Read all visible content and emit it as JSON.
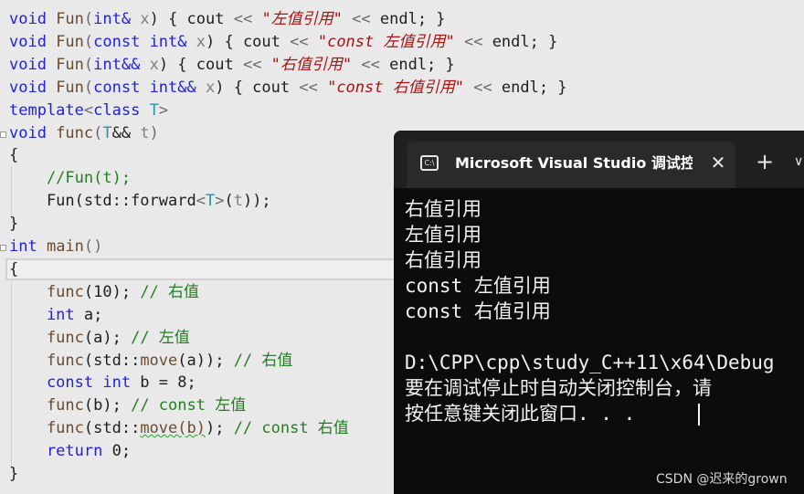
{
  "editor": {
    "lines": [
      {
        "tokens": [
          {
            "t": "void",
            "c": "kw"
          },
          {
            "t": " Fun",
            "c": "fn"
          },
          {
            "t": "(",
            "c": "op"
          },
          {
            "t": "int&",
            "c": "kw"
          },
          {
            "t": " x",
            "c": "prm"
          },
          {
            "t": ") { cout ",
            "c": ""
          },
          {
            "t": "<<",
            "c": "op"
          },
          {
            "t": " \"左值引用\"",
            "c": "str"
          },
          {
            "t": " << ",
            "c": "op"
          },
          {
            "t": "endl; }",
            "c": ""
          }
        ]
      },
      {
        "tokens": [
          {
            "t": "void",
            "c": "kw"
          },
          {
            "t": " Fun",
            "c": "fn"
          },
          {
            "t": "(",
            "c": "op"
          },
          {
            "t": "const int&",
            "c": "kw"
          },
          {
            "t": " x",
            "c": "prm"
          },
          {
            "t": ") { cout ",
            "c": ""
          },
          {
            "t": "<<",
            "c": "op"
          },
          {
            "t": " \"const 左值引用\"",
            "c": "str"
          },
          {
            "t": " << ",
            "c": "op"
          },
          {
            "t": "endl; }",
            "c": ""
          }
        ]
      },
      {
        "tokens": [
          {
            "t": "void",
            "c": "kw"
          },
          {
            "t": " Fun",
            "c": "fn"
          },
          {
            "t": "(",
            "c": "op"
          },
          {
            "t": "int&&",
            "c": "kw"
          },
          {
            "t": " x",
            "c": "prm"
          },
          {
            "t": ") { cout ",
            "c": ""
          },
          {
            "t": "<<",
            "c": "op"
          },
          {
            "t": " \"右值引用\"",
            "c": "str"
          },
          {
            "t": " << ",
            "c": "op"
          },
          {
            "t": "endl; }",
            "c": ""
          }
        ]
      },
      {
        "tokens": [
          {
            "t": "void",
            "c": "kw"
          },
          {
            "t": " Fun",
            "c": "fn"
          },
          {
            "t": "(",
            "c": "op"
          },
          {
            "t": "const int&&",
            "c": "kw"
          },
          {
            "t": " x",
            "c": "prm"
          },
          {
            "t": ") { cout ",
            "c": ""
          },
          {
            "t": "<<",
            "c": "op"
          },
          {
            "t": " \"const 右值引用\"",
            "c": "str"
          },
          {
            "t": " << ",
            "c": "op"
          },
          {
            "t": "endl; }",
            "c": ""
          }
        ]
      },
      {
        "tokens": [
          {
            "t": "template",
            "c": "kw"
          },
          {
            "t": "<",
            "c": "op"
          },
          {
            "t": "class",
            "c": "kw"
          },
          {
            "t": " T",
            "c": "tp"
          },
          {
            "t": ">",
            "c": "op"
          }
        ]
      },
      {
        "tokens": [
          {
            "t": "void",
            "c": "kw"
          },
          {
            "t": " func",
            "c": "fn"
          },
          {
            "t": "(",
            "c": "op"
          },
          {
            "t": "T",
            "c": "tp"
          },
          {
            "t": "&& ",
            "c": ""
          },
          {
            "t": "t",
            "c": "prm"
          },
          {
            "t": ")",
            "c": "op"
          }
        ]
      },
      {
        "tokens": [
          {
            "t": "{",
            "c": ""
          }
        ]
      },
      {
        "tokens": [
          {
            "t": "    //Fun(t);",
            "c": "cm"
          }
        ]
      },
      {
        "tokens": [
          {
            "t": "    Fun(std::forward",
            "c": ""
          },
          {
            "t": "<",
            "c": "op"
          },
          {
            "t": "T",
            "c": "tp"
          },
          {
            "t": ">",
            "c": "op"
          },
          {
            "t": "(",
            "c": ""
          },
          {
            "t": "t",
            "c": "prm"
          },
          {
            "t": "));",
            "c": ""
          }
        ]
      },
      {
        "tokens": [
          {
            "t": "}",
            "c": ""
          }
        ]
      },
      {
        "tokens": [
          {
            "t": "int",
            "c": "kw"
          },
          {
            "t": " main",
            "c": "fn"
          },
          {
            "t": "()",
            "c": "op"
          }
        ]
      },
      {
        "tokens": [
          {
            "t": "{",
            "c": ""
          }
        ]
      },
      {
        "tokens": [
          {
            "t": "    func",
            "c": "fn"
          },
          {
            "t": "(10); ",
            "c": ""
          },
          {
            "t": "// 右值",
            "c": "cm"
          }
        ]
      },
      {
        "tokens": [
          {
            "t": "    int",
            "c": "kw"
          },
          {
            "t": " a;",
            "c": ""
          }
        ]
      },
      {
        "tokens": [
          {
            "t": "    func",
            "c": "fn"
          },
          {
            "t": "(a); ",
            "c": ""
          },
          {
            "t": "// 左值",
            "c": "cm"
          }
        ]
      },
      {
        "tokens": [
          {
            "t": "    func",
            "c": "fn"
          },
          {
            "t": "(std::",
            "c": ""
          },
          {
            "t": "move",
            "c": "fn"
          },
          {
            "t": "(a)); ",
            "c": ""
          },
          {
            "t": "// 右值",
            "c": "cm"
          }
        ]
      },
      {
        "tokens": [
          {
            "t": "    const int",
            "c": "kw"
          },
          {
            "t": " b = 8;",
            "c": ""
          }
        ]
      },
      {
        "tokens": [
          {
            "t": "    func",
            "c": "fn"
          },
          {
            "t": "(b); ",
            "c": ""
          },
          {
            "t": "// const 左值",
            "c": "cm"
          }
        ]
      },
      {
        "tokens": [
          {
            "t": "    func",
            "c": "fn"
          },
          {
            "t": "(std::",
            "c": ""
          },
          {
            "t": "move(b)",
            "c": "fn squiggle"
          },
          {
            "t": "); ",
            "c": ""
          },
          {
            "t": "// const 右值",
            "c": "cm"
          }
        ]
      },
      {
        "tokens": [
          {
            "t": "    return",
            "c": "kw"
          },
          {
            "t": " 0;",
            "c": ""
          }
        ]
      },
      {
        "tokens": [
          {
            "t": "}",
            "c": ""
          }
        ]
      }
    ]
  },
  "console": {
    "tab_title": "Microsoft Visual Studio 调试控",
    "tab_icon": "terminal-icon",
    "close_glyph": "✕",
    "new_tab_glyph": "+",
    "dropdown_glyph": "∨",
    "output": [
      "右值引用",
      "左值引用",
      "右值引用",
      "const 左值引用",
      "const 右值引用",
      "",
      "D:\\CPP\\cpp\\study_C++11\\x64\\Debug",
      "要在调试停止时自动关闭控制台，请",
      "按任意键关闭此窗口. . ."
    ]
  },
  "watermark": "CSDN @迟来的grown"
}
